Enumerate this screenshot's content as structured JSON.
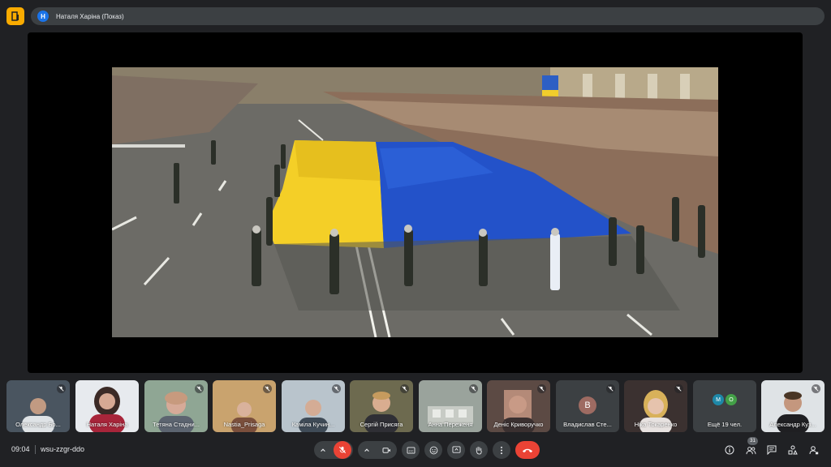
{
  "presenter": {
    "initial": "Н",
    "label": "Наталя Харіна (Показ)"
  },
  "participants": [
    {
      "name": "Олександр Бо...",
      "muted": true
    },
    {
      "name": "Наталя Харіна",
      "muted": false
    },
    {
      "name": "Тетяна Стадни...",
      "muted": true
    },
    {
      "name": "Nastia_Prisaga",
      "muted": true
    },
    {
      "name": "Каміла Кучин...",
      "muted": true
    },
    {
      "name": "Сергій Присяга",
      "muted": true
    },
    {
      "name": "Анна Переженя",
      "muted": true
    },
    {
      "name": "Деніс Криворучко",
      "muted": true
    },
    {
      "name": "Владислав Сте...",
      "muted": true,
      "avatar_letter": "В"
    },
    {
      "name": "Ніка Токаренко",
      "muted": true
    },
    {
      "name": "Ещё 19 чел.",
      "muted": false,
      "avatars": [
        "M",
        "O"
      ]
    },
    {
      "name": "Александр Куз...",
      "muted": true
    }
  ],
  "bottom": {
    "time": "09:04",
    "meeting_code": "wsu-zzgr-ddo",
    "people_count": "31"
  },
  "colors": {
    "background": "#202124",
    "control": "#3c4043",
    "danger": "#ea4335",
    "accent_yellow": "#f9ab00",
    "flag_blue": "#2352c9",
    "flag_yellow": "#f4cf27"
  },
  "icons": {
    "mic": "mic-off-icon",
    "camera": "camera-icon",
    "captions": "cc-icon",
    "emoji": "emoji-icon",
    "present": "present-icon",
    "hand": "hand-icon",
    "more": "more-vert-icon",
    "hangup": "call-end-icon",
    "info": "info-icon",
    "people": "people-icon",
    "chat": "chat-icon",
    "activities": "activities-icon",
    "lock": "host-controls-icon"
  }
}
